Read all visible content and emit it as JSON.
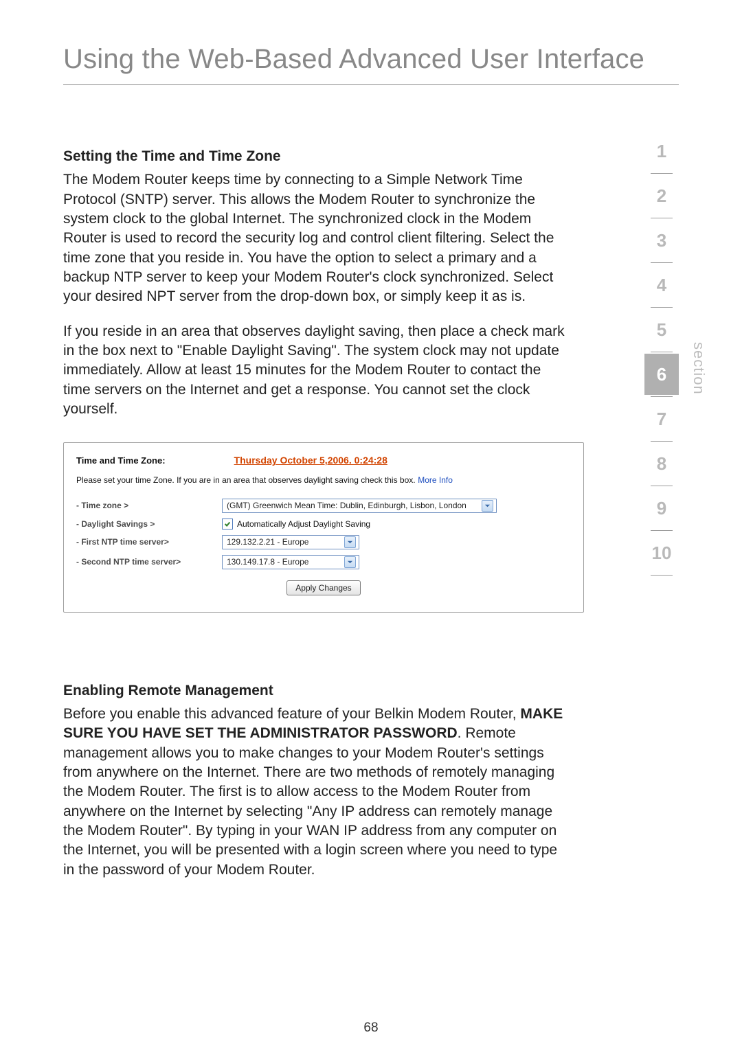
{
  "header": {
    "title": "Using the Web-Based Advanced User Interface"
  },
  "sectionNav": {
    "items": [
      "1",
      "2",
      "3",
      "4",
      "5",
      "6",
      "7",
      "8",
      "9",
      "10"
    ],
    "active": "6",
    "sideLabel": "section"
  },
  "content": {
    "h1": "Setting the Time and Time Zone",
    "p1": "The Modem Router keeps time by connecting to a Simple Network Time Protocol (SNTP) server. This allows the Modem Router to synchronize the system clock to the global Internet. The synchronized clock in the Modem Router is used to record the security log and control client filtering. Select the time zone that you reside in. You have the option to select a primary and a backup NTP server to keep your Modem Router's clock synchronized. Select your desired NPT server from the drop-down box, or simply keep it as is.",
    "p2": "If you reside in an area that observes daylight saving, then place a check mark in the box next to \"Enable Daylight Saving\". The system clock may not update immediately. Allow at least 15 minutes for the Modem Router to contact the time servers on the Internet and get a response. You cannot set the clock yourself.",
    "h2": "Enabling Remote Management",
    "p3a": "Before you enable this advanced feature of your Belkin Modem Router, ",
    "p3warn": "MAKE SURE YOU HAVE SET THE ADMINISTRATOR PASSWORD",
    "p3b": ". Remote management allows you to make changes to your Modem Router's settings from anywhere on the Internet. There are two methods of remotely managing the Modem Router. The first is to allow access to the Modem Router from anywhere on the Internet by selecting \"Any IP address can remotely manage the Modem Router\". By typing in your WAN IP address from any computer on the Internet, you will be presented with a login screen where you need to type in the password of your Modem Router."
  },
  "tzPanel": {
    "headerLabel": "Time and Time Zone:",
    "headerDate": "Thursday October 5,2006. 0:24:28",
    "desc": "Please set your time Zone. If you are in an area that observes daylight saving check this box.",
    "moreInfo": "More Info",
    "rows": {
      "timezoneLabel": "- Time zone >",
      "timezoneValue": "(GMT) Greenwich Mean Time: Dublin, Edinburgh, Lisbon, London",
      "daylightLabel": "- Daylight Savings >",
      "daylightText": "Automatically Adjust Daylight Saving",
      "daylightChecked": true,
      "ntp1Label": "- First NTP time server>",
      "ntp1Value": "129.132.2.21 - Europe",
      "ntp2Label": "- Second NTP time server>",
      "ntp2Value": "130.149.17.8 - Europe"
    },
    "applyLabel": "Apply Changes"
  },
  "pageNumber": "68"
}
